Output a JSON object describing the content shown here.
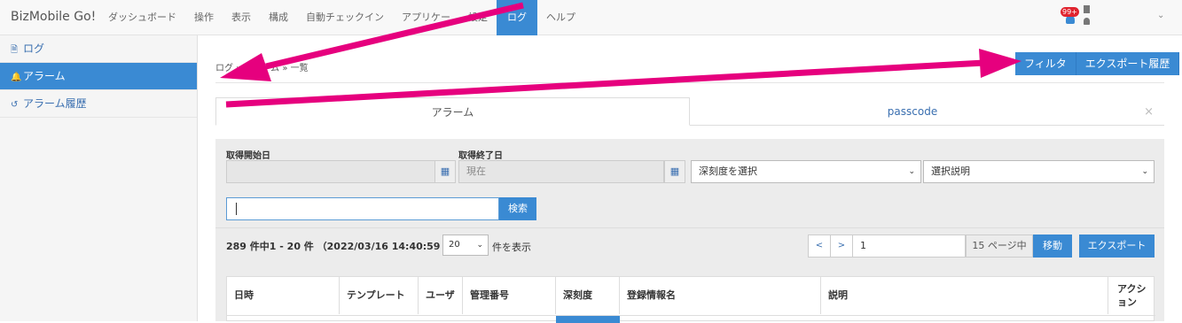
{
  "brand": "BizMobile Go!",
  "nav": [
    "ダッシュボード",
    "操作",
    "表示",
    "構成",
    "自動チェックイン",
    "アプリケー",
    "設定",
    "ログ",
    "ヘルプ"
  ],
  "nav_active": "ログ",
  "badge": "99+",
  "sidebar": {
    "items": [
      {
        "label": "ログ",
        "icon": "document-icon"
      },
      {
        "label": "アラーム",
        "icon": "bell-icon"
      },
      {
        "label": "アラーム履歴",
        "icon": "history-icon"
      }
    ]
  },
  "breadcrumb": "ログ » アラーム » 一覧",
  "top_buttons": {
    "filter": "フィルタ",
    "export_history": "エクスポート履歴"
  },
  "tabs": {
    "tab1": "アラーム",
    "tab2": "passcode",
    "close": "×"
  },
  "filters": {
    "start_label": "取得開始日",
    "end_label": "取得終了日",
    "end_value": "現在",
    "severity_placeholder": "深刻度を選択",
    "description_placeholder": "選択説明"
  },
  "search": {
    "button": "検索"
  },
  "results": {
    "count_text": "289 件中1 - 20 件 （2022/03/16 14:40:59 以前）",
    "per_page": "20",
    "per_page_suffix": "件を表示"
  },
  "pager": {
    "prev": "<",
    "next": ">",
    "page": "1",
    "of": "15 ページ中",
    "move": "移動",
    "export": "エクスポート"
  },
  "table": {
    "headers": [
      "日時",
      "テンプレート",
      "ユーザ",
      "管理番号",
      "深刻度",
      "登録情報名",
      "説明",
      "アクション"
    ]
  },
  "colors": {
    "accent": "#3a8ad3",
    "annotation": "#e6007e"
  }
}
